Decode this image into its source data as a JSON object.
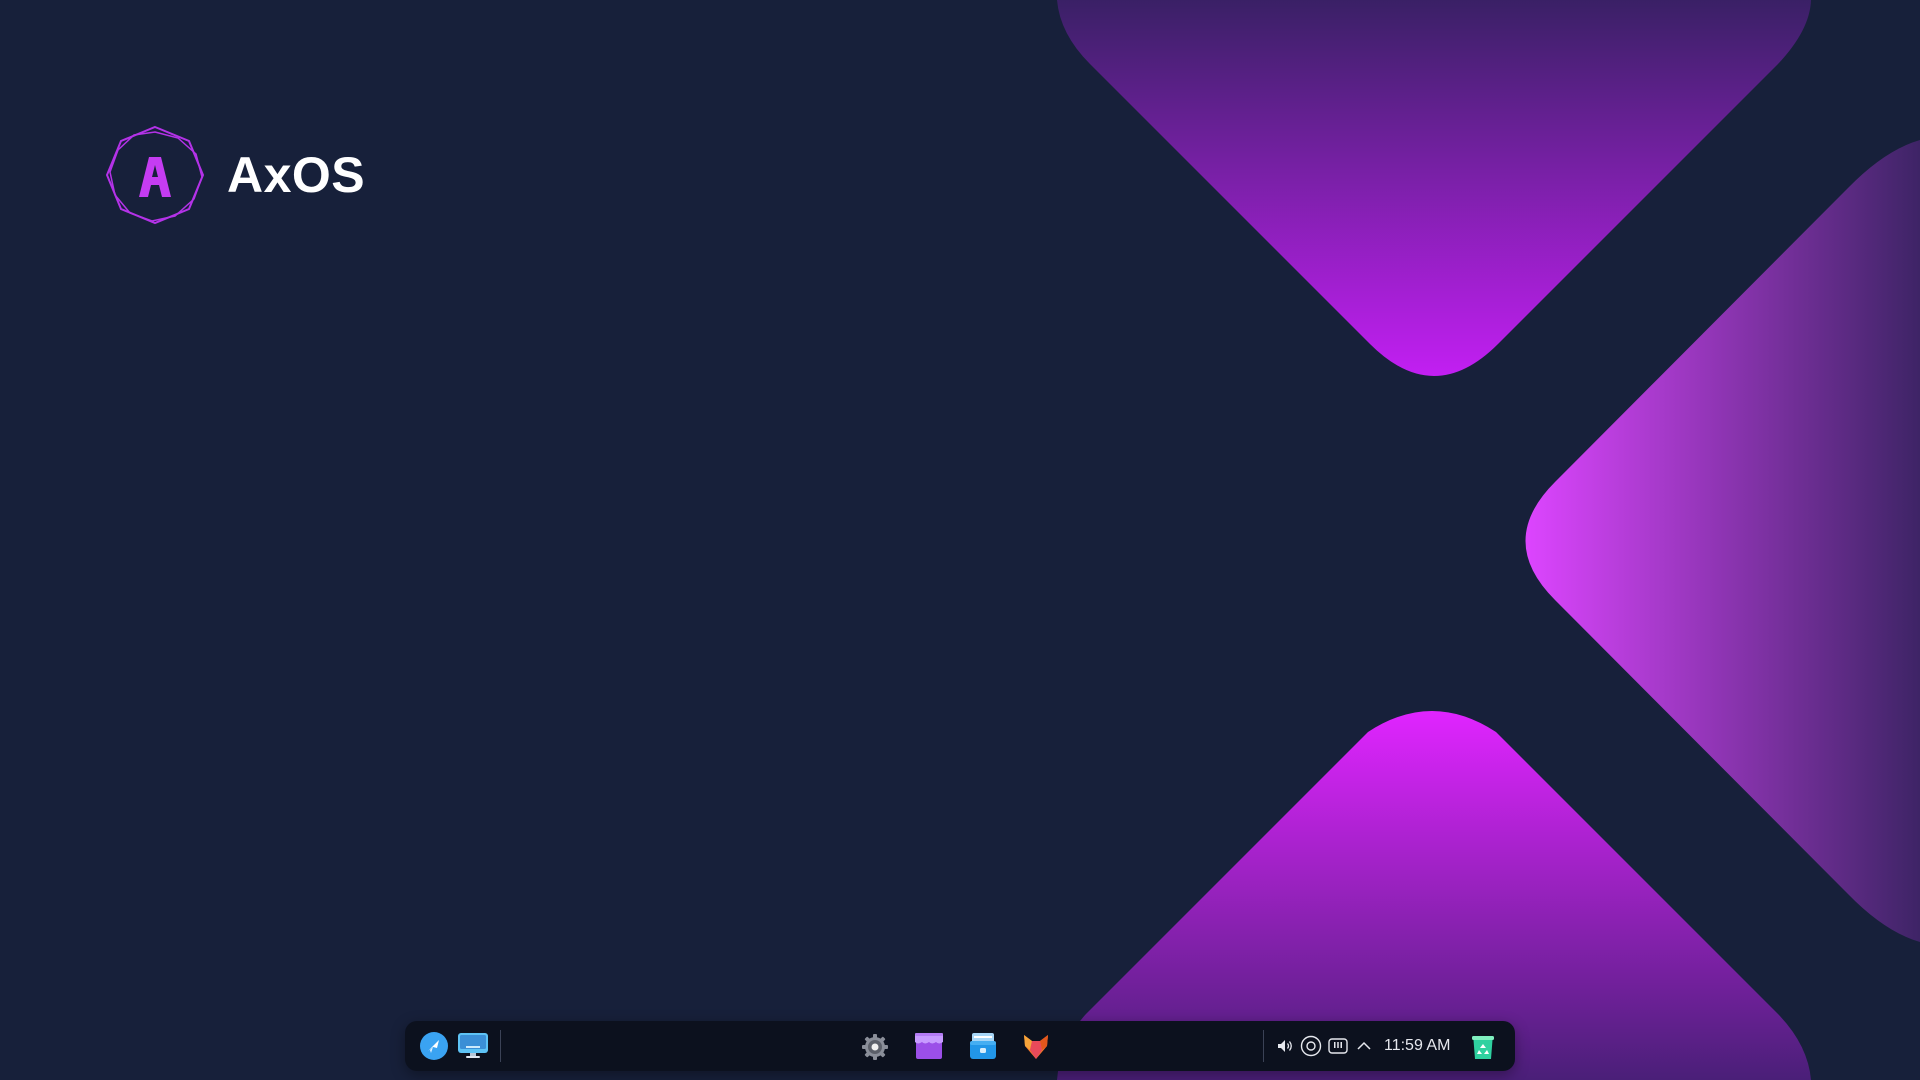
{
  "desktop": {
    "os_name": "AxOS",
    "wallpaper": {
      "background_color": "#17203a",
      "accent_colors": [
        "#e026ff",
        "#b43de8",
        "#5a1f86",
        "#3a2060"
      ]
    }
  },
  "taskbar": {
    "left_items": [
      {
        "name": "launcher-icon"
      },
      {
        "name": "show-desktop-icon"
      }
    ],
    "pinned_apps": [
      {
        "name": "settings-gear-icon"
      },
      {
        "name": "app-store-icon"
      },
      {
        "name": "file-manager-icon"
      },
      {
        "name": "firefox-browser-icon"
      }
    ],
    "tray": {
      "icons": [
        "volume-icon",
        "network-icon",
        "keyboard-icon",
        "chevron-up-icon"
      ],
      "clock": "11:59 AM",
      "trash_icon": "trash-recycle-icon"
    }
  }
}
